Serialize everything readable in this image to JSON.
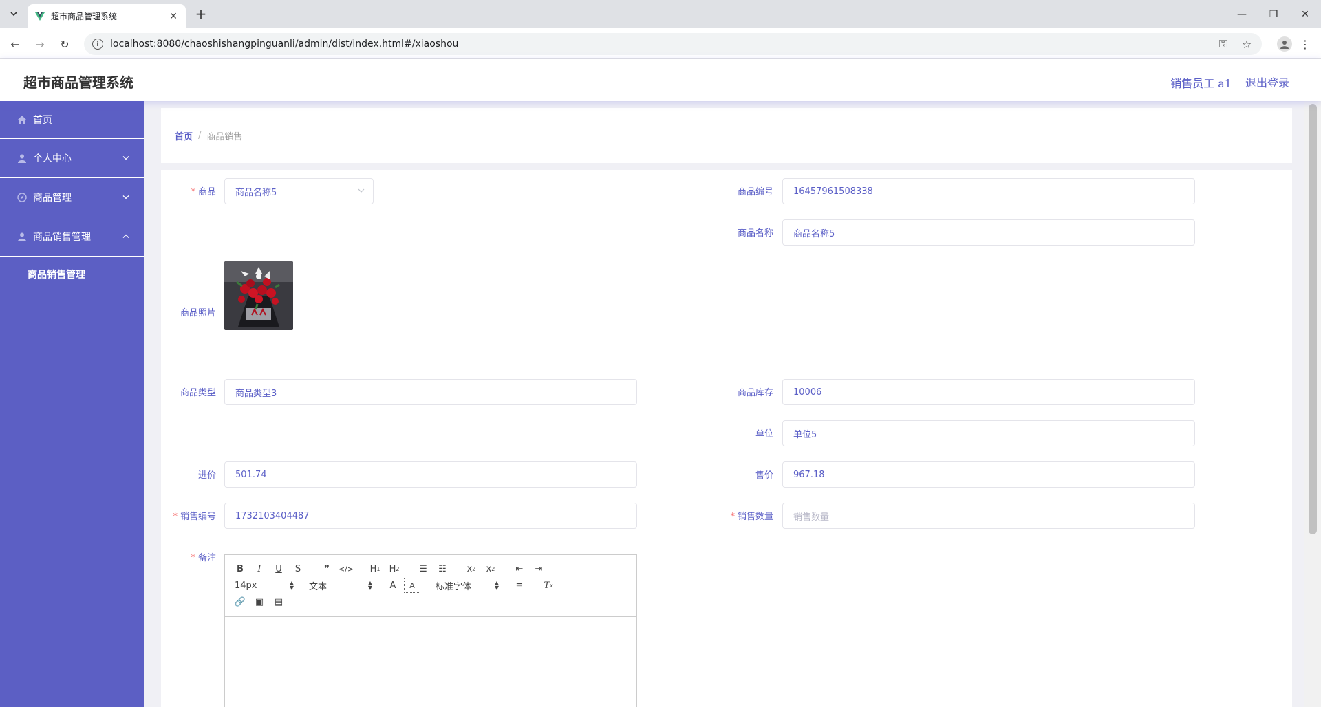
{
  "browser": {
    "tab_title": "超市商品管理系统",
    "url": "localhost:8080/chaoshishangpinguanli/admin/dist/index.html#/xiaoshou"
  },
  "header": {
    "app_title": "超市商品管理系统",
    "user": "销售员工 a1",
    "logout": "退出登录"
  },
  "sidebar": {
    "items": [
      {
        "label": "首页",
        "icon": "home-icon"
      },
      {
        "label": "个人中心",
        "icon": "user-icon"
      },
      {
        "label": "商品管理",
        "icon": "compass-icon"
      },
      {
        "label": "商品销售管理",
        "icon": "user-icon"
      }
    ],
    "submenu_label": "商品销售管理"
  },
  "breadcrumb": {
    "home": "首页",
    "separator": "/",
    "current": "商品销售"
  },
  "form": {
    "product_label": "商品",
    "product_value": "商品名称5",
    "code_label": "商品编号",
    "code_value": "16457961508338",
    "name_label": "商品名称",
    "name_value": "商品名称5",
    "photo_label": "商品照片",
    "type_label": "商品类型",
    "type_value": "商品类型3",
    "stock_label": "商品库存",
    "stock_value": "10006",
    "unit_label": "单位",
    "unit_value": "单位5",
    "cost_label": "进价",
    "cost_value": "501.74",
    "price_label": "售价",
    "price_value": "967.18",
    "sale_no_label": "销售编号",
    "sale_no_value": "1732103404487",
    "qty_label": "销售数量",
    "qty_placeholder": "销售数量",
    "remark_label": "备注"
  },
  "editor": {
    "font_size": "14px",
    "text_style": "文本",
    "font_family": "标准字体"
  },
  "colors": {
    "accent": "#5b5fc7",
    "sidebar": "#5c5fc4",
    "required": "#f56c6c"
  }
}
